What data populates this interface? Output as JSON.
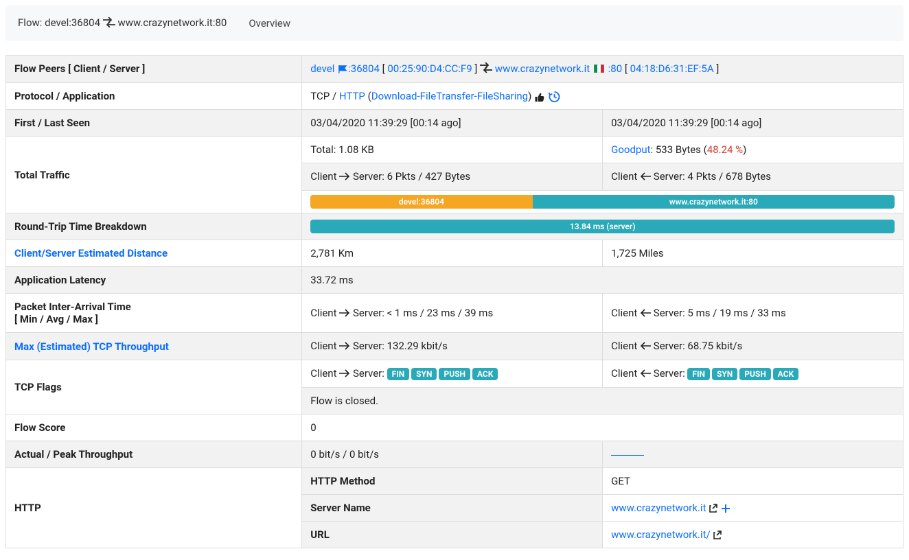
{
  "header": {
    "prefix": "Flow: ",
    "client": "devel:36804",
    "server": "www.crazynetwork.it:80",
    "tab": "Overview"
  },
  "labels": {
    "flow_peers": "Flow Peers [ Client / Server ]",
    "protocol": "Protocol / Application",
    "first_last": "First / Last Seen",
    "total_traffic": "Total Traffic",
    "rtt": "Round-Trip Time Breakdown",
    "distance": "Client/Server Estimated Distance",
    "app_latency": "Application Latency",
    "inter_arrival_l1": "Packet Inter-Arrival Time",
    "inter_arrival_l2": "[ Min / Avg / Max ]",
    "max_tcp": "Max (Estimated) TCP Throughput",
    "tcp_flags": "TCP Flags",
    "flow_score": "Flow Score",
    "actual_peak": "Actual / Peak Throughput",
    "http": "HTTP",
    "http_method": "HTTP Method",
    "server_name": "Server Name",
    "url": "URL"
  },
  "peers": {
    "client_name": "devel",
    "client_port": ":36804",
    "client_mac": "00:25:90:D4:CC:F9",
    "server_name": "www.crazynetwork.it",
    "server_port": ":80",
    "server_mac": "04:18:D6:31:EF:5A"
  },
  "protocol": {
    "base": "TCP / ",
    "proto": "HTTP",
    "lp": " (",
    "category": "Download-FileTransfer-FileSharing",
    "rp": ") "
  },
  "seen": {
    "first": "03/04/2020 11:39:29 [00:14 ago]",
    "last": "03/04/2020 11:39:29 [00:14 ago]"
  },
  "traffic": {
    "total": "Total: 1.08 KB",
    "goodput_label": "Goodput",
    "goodput_value": ": 533 Bytes (",
    "goodput_pct": "48.24 %",
    "rp": ")",
    "client_prefix": "Client ",
    "c2s_rest": " Server: 6 Pkts / 427 Bytes",
    "s2c_rest": " Server: 4 Pkts / 678 Bytes",
    "bar_client_label": "devel:36804",
    "bar_server_label": "www.crazynetwork.it:80",
    "bar_client_pct": 38,
    "bar_server_pct": 62
  },
  "rtt": {
    "label": "13.84 ms (server)"
  },
  "distance": {
    "km": "2,781 Km",
    "miles": "1,725 Miles"
  },
  "latency": "33.72 ms",
  "inter": {
    "c2s": " Server: < 1 ms / 23 ms / 39 ms",
    "s2c": " Server: 5 ms / 19 ms / 33 ms"
  },
  "maxtcp": {
    "c2s": " Server: 132.29 kbit/s",
    "s2c": " Server: 68.75 kbit/s"
  },
  "flags": {
    "prefix": " Server: ",
    "fin": "FIN",
    "syn": "SYN",
    "push": "PUSH",
    "ack": "ACK",
    "closed": "Flow is closed."
  },
  "score": "0",
  "throughput": "0 bit/s / 0 bit/s",
  "http": {
    "method": "GET",
    "server": "www.crazynetwork.it",
    "url": "www.crazynetwork.it/"
  }
}
